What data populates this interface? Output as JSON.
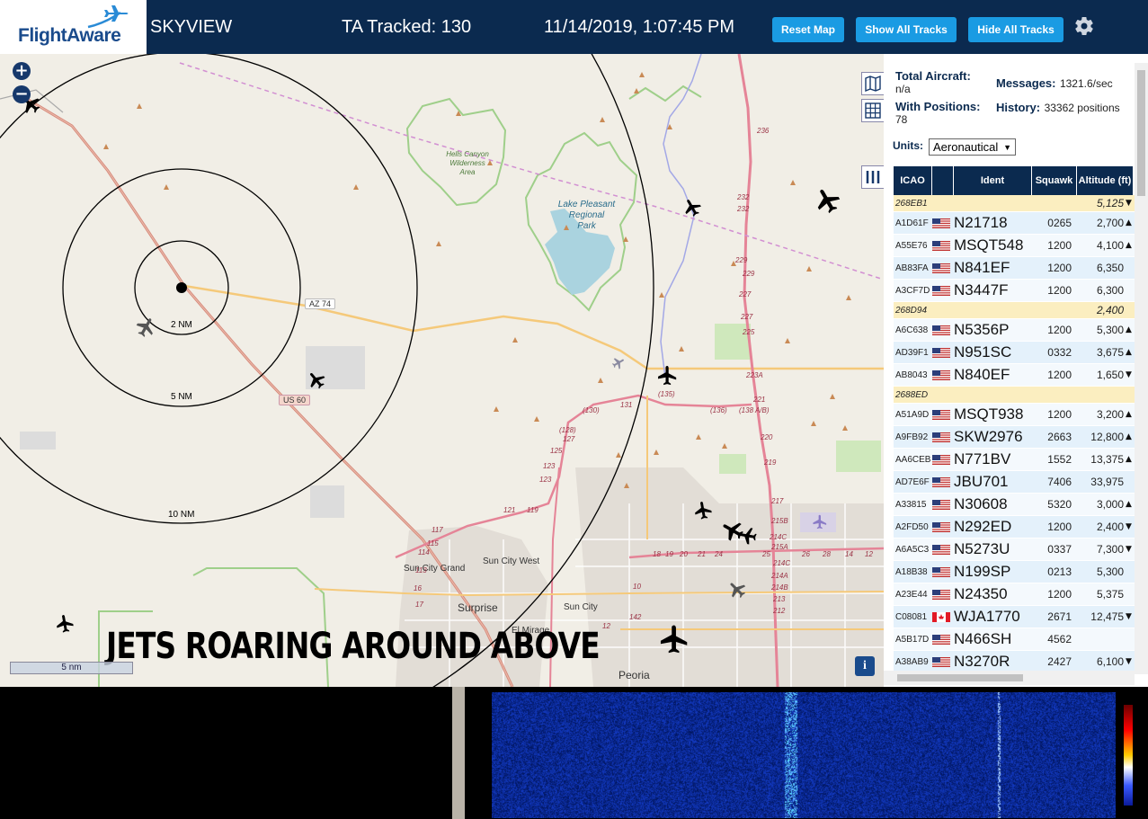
{
  "header": {
    "logo_text": "FlightAware",
    "app_title": "SKYVIEW",
    "tracked": "TA Tracked: 130",
    "datetime": "11/14/2019, 1:07:45 PM",
    "btn_reset": "Reset Map",
    "btn_show": "Show All Tracks",
    "btn_hide": "Hide All Tracks",
    "gear_icon": "gear-icon"
  },
  "map": {
    "zoom_in": "+",
    "zoom_out": "−",
    "caption": "JETS ROARING AROUND ABOVE",
    "scale_label": "5 nm",
    "info": "i",
    "range_labels": [
      "2 NM",
      "5 NM",
      "10 NM"
    ],
    "place_labels": {
      "hells_canyon": [
        "Hells Canyon",
        "Wilderness",
        "Area"
      ],
      "lake_pleasant": [
        "Lake Pleasant",
        "Regional",
        "Park"
      ],
      "sun_city_grand": "Sun City Grand",
      "sun_city_west": "Sun City West",
      "surprise": "Surprise",
      "el_mirage": "El Mirage",
      "sun_city": "Sun City",
      "peoria": "Peoria",
      "az74": "AZ 74",
      "us60": "US 60"
    },
    "road_numbers": [
      "236",
      "232",
      "232",
      "229",
      "229",
      "227",
      "227",
      "225",
      "223A",
      "221",
      "220",
      "219",
      "217",
      "215B",
      "214C",
      "215A",
      "214C",
      "214A",
      "214B",
      "213",
      "212",
      "(136)",
      "(138 A/B)",
      "(135)",
      "131",
      "(130)",
      "(128)",
      "127",
      "125",
      "123",
      "123",
      "121",
      "119",
      "117",
      "115",
      "114",
      "113",
      "16",
      "17",
      "18",
      "19",
      "20",
      "21",
      "24",
      "25",
      "26",
      "28",
      "14",
      "12",
      "10",
      "142",
      "12"
    ]
  },
  "panel": {
    "total_label": "Total Aircraft:",
    "total_value": "n/a",
    "positions_label": "With Positions:",
    "positions_value": "78",
    "messages_label": "Messages:",
    "messages_value": "1321.6/sec",
    "history_label": "History:",
    "history_value": "33362 positions",
    "units_label": "Units:",
    "units_value": "Aeronautical",
    "columns": [
      "ICAO",
      "",
      "Ident",
      "Squawk",
      "Altitude (ft)"
    ],
    "rows": [
      {
        "icao": "268EB1",
        "flag": "",
        "ident": "",
        "squawk": "",
        "alt": "5,125",
        "trend": "▼",
        "hl": true
      },
      {
        "icao": "A1D61F",
        "flag": "us",
        "ident": "N21718",
        "squawk": "0265",
        "alt": "2,700",
        "trend": "▲"
      },
      {
        "icao": "A55E76",
        "flag": "us",
        "ident": "MSQT548",
        "squawk": "1200",
        "alt": "4,100",
        "trend": "▲"
      },
      {
        "icao": "AB83FA",
        "flag": "us",
        "ident": "N841EF",
        "squawk": "1200",
        "alt": "6,350",
        "trend": ""
      },
      {
        "icao": "A3CF7D",
        "flag": "us",
        "ident": "N3447F",
        "squawk": "1200",
        "alt": "6,300",
        "trend": ""
      },
      {
        "icao": "268D94",
        "flag": "",
        "ident": "",
        "squawk": "",
        "alt": "2,400",
        "trend": "",
        "hl": true
      },
      {
        "icao": "A6C638",
        "flag": "us",
        "ident": "N5356P",
        "squawk": "1200",
        "alt": "5,300",
        "trend": "▲"
      },
      {
        "icao": "AD39F1",
        "flag": "us",
        "ident": "N951SC",
        "squawk": "0332",
        "alt": "3,675",
        "trend": "▲"
      },
      {
        "icao": "AB8043",
        "flag": "us",
        "ident": "N840EF",
        "squawk": "1200",
        "alt": "1,650",
        "trend": "▼"
      },
      {
        "icao": "2688ED",
        "flag": "",
        "ident": "",
        "squawk": "",
        "alt": "",
        "trend": "",
        "hl": true
      },
      {
        "icao": "A51A9D",
        "flag": "us",
        "ident": "MSQT938",
        "squawk": "1200",
        "alt": "3,200",
        "trend": "▲"
      },
      {
        "icao": "A9FB92",
        "flag": "us",
        "ident": "SKW2976",
        "squawk": "2663",
        "alt": "12,800",
        "trend": "▲"
      },
      {
        "icao": "AA6CEB",
        "flag": "us",
        "ident": "N771BV",
        "squawk": "1552",
        "alt": "13,375",
        "trend": "▲"
      },
      {
        "icao": "AD7E6F",
        "flag": "us",
        "ident": "JBU701",
        "squawk": "7406",
        "alt": "33,975",
        "trend": ""
      },
      {
        "icao": "A33815",
        "flag": "us",
        "ident": "N30608",
        "squawk": "5320",
        "alt": "3,000",
        "trend": "▲"
      },
      {
        "icao": "A2FD50",
        "flag": "us",
        "ident": "N292ED",
        "squawk": "1200",
        "alt": "2,400",
        "trend": "▼"
      },
      {
        "icao": "A6A5C3",
        "flag": "us",
        "ident": "N5273U",
        "squawk": "0337",
        "alt": "7,300",
        "trend": "▼"
      },
      {
        "icao": "A18B38",
        "flag": "us",
        "ident": "N199SP",
        "squawk": "0213",
        "alt": "5,300",
        "trend": ""
      },
      {
        "icao": "A23E44",
        "flag": "us",
        "ident": "N24350",
        "squawk": "1200",
        "alt": "5,375",
        "trend": ""
      },
      {
        "icao": "C08081",
        "flag": "ca",
        "ident": "WJA1770",
        "squawk": "2671",
        "alt": "12,475",
        "trend": "▼"
      },
      {
        "icao": "A5B17D",
        "flag": "us",
        "ident": "N466SH",
        "squawk": "4562",
        "alt": "",
        "trend": ""
      },
      {
        "icao": "A38AB9",
        "flag": "us",
        "ident": "N3270R",
        "squawk": "2427",
        "alt": "6,100",
        "trend": "▼"
      }
    ]
  }
}
